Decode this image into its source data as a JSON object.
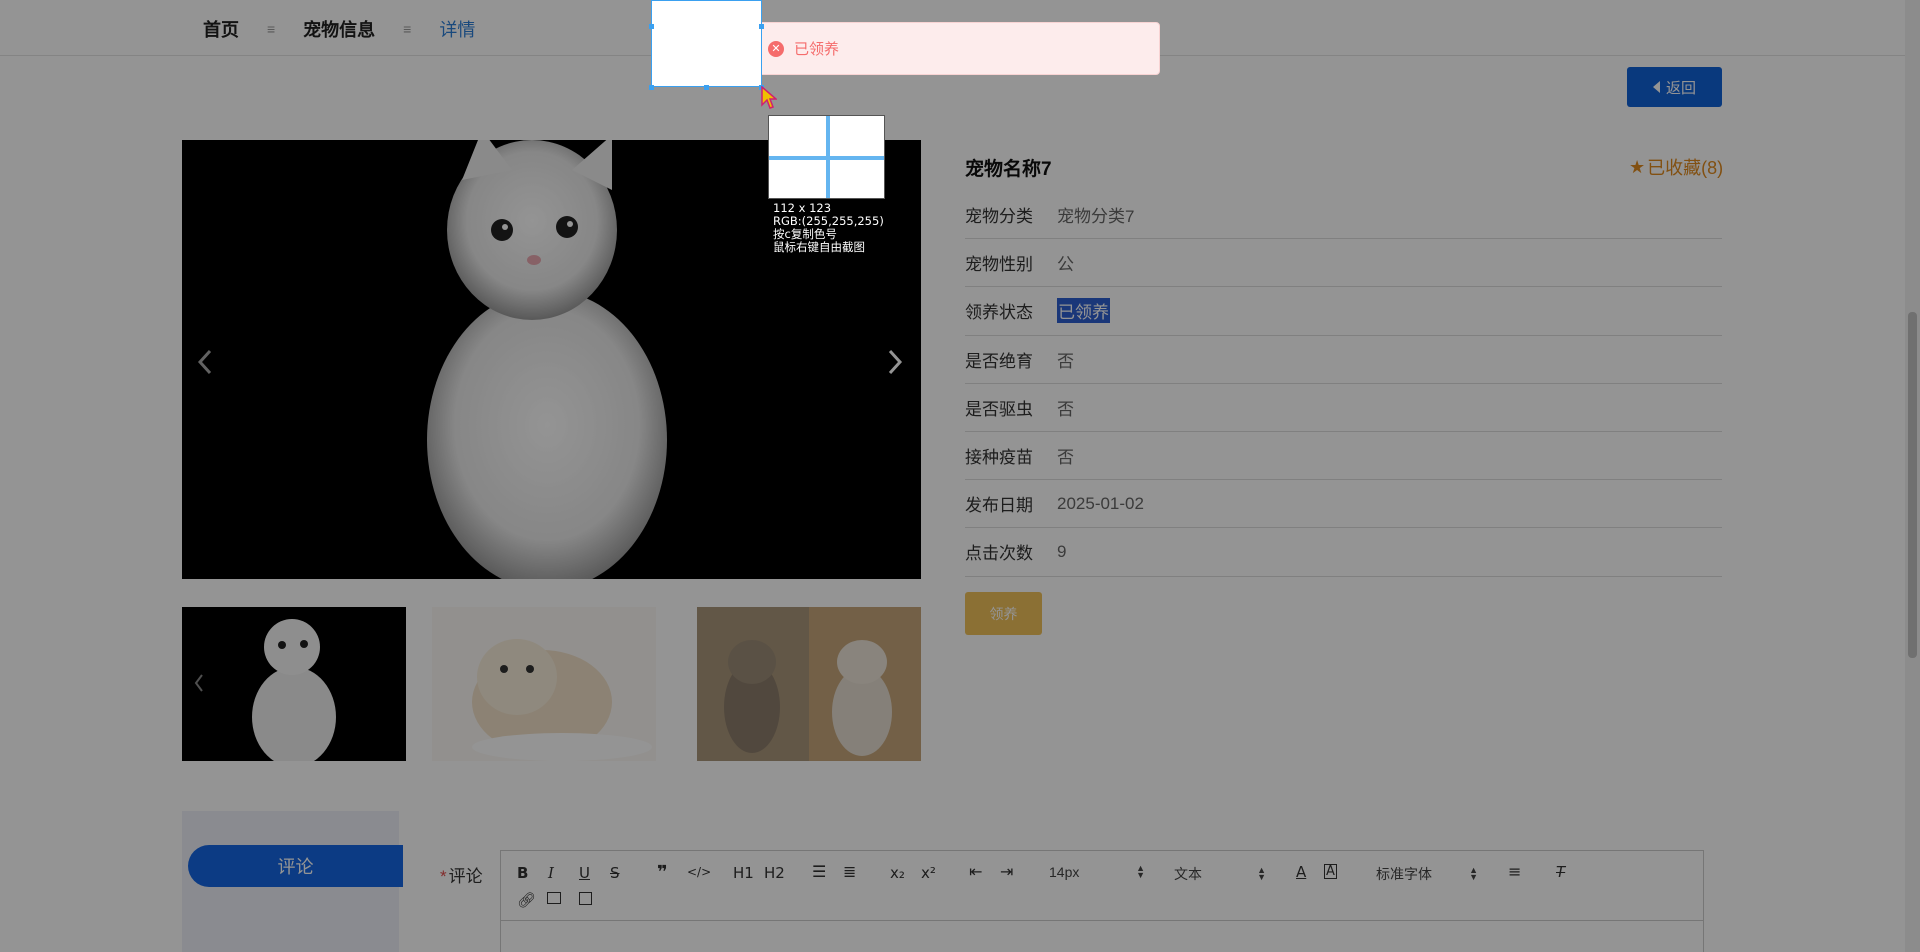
{
  "breadcrumb": {
    "items": [
      {
        "label": "首页"
      },
      {
        "label": "宠物信息"
      },
      {
        "label": "详情"
      }
    ],
    "separator": "≡"
  },
  "back_button": {
    "label": "返回"
  },
  "pet": {
    "name": "宠物名称7",
    "favorite": "已收藏(8)",
    "fields": [
      {
        "label": "宠物分类",
        "value": "宠物分类7"
      },
      {
        "label": "宠物性别",
        "value": "公"
      },
      {
        "label": "领养状态",
        "value": "已领养"
      },
      {
        "label": "是否绝育",
        "value": "否"
      },
      {
        "label": "是否驱虫",
        "value": "否"
      },
      {
        "label": "接种疫苗",
        "value": "否"
      },
      {
        "label": "发布日期",
        "value": "2025-01-02"
      },
      {
        "label": "点击次数",
        "value": "9"
      }
    ],
    "adopt_button": "领养"
  },
  "comment": {
    "tab_label": "评论",
    "field_label": "评论",
    "required_mark": "*",
    "toolbar": {
      "font_size": "14px",
      "text_style": "文本",
      "font_family": "标准字体",
      "buttons": [
        "B",
        "I",
        "U",
        "S",
        "❞",
        "</>",
        "H1",
        "H2",
        "ordered-list",
        "bullet-list",
        "x₂",
        "x²",
        "outdent",
        "indent",
        "font-color",
        "background-color",
        "align",
        "clear-format",
        "link",
        "image",
        "video"
      ]
    }
  },
  "toast": {
    "message": "已领养",
    "type": "error"
  },
  "screenshot_tool": {
    "size_text": "112 x 123",
    "rgb_text": "RGB:(255,255,255)",
    "hint_copy": "按c复制色号",
    "hint_right": "鼠标右键自由截图"
  },
  "colors": {
    "primary": "#1162d8",
    "accent": "#e08a1e",
    "adopt": "#f0c25a",
    "error": "#f56c6c"
  }
}
